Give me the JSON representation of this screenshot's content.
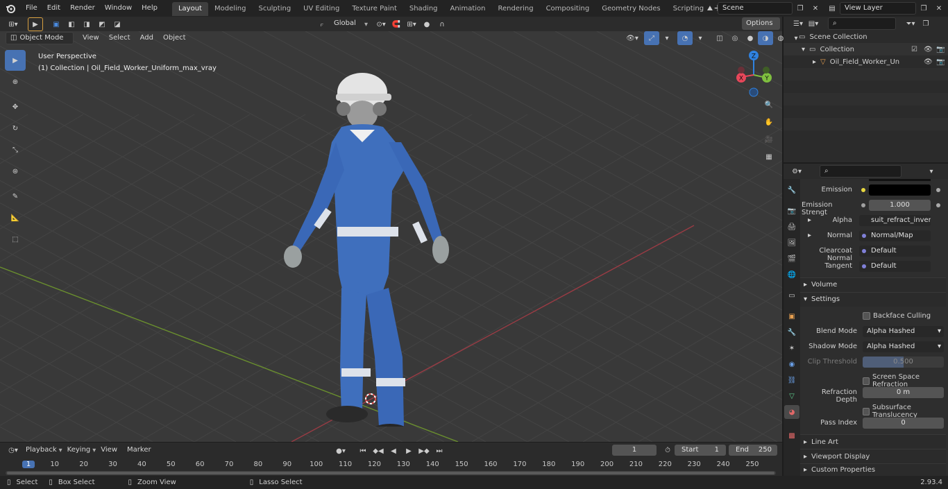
{
  "topbar": {
    "menus": [
      "File",
      "Edit",
      "Render",
      "Window",
      "Help"
    ],
    "workspaces": [
      "Layout",
      "Modeling",
      "Sculpting",
      "UV Editing",
      "Texture Paint",
      "Shading",
      "Animation",
      "Rendering",
      "Compositing",
      "Geometry Nodes",
      "Scripting"
    ],
    "active_workspace": "Layout",
    "scene": "Scene",
    "view_layer": "View Layer"
  },
  "viewport": {
    "mode": "Object Mode",
    "menus": [
      "View",
      "Select",
      "Add",
      "Object"
    ],
    "transform": "Global",
    "options": "Options",
    "perspective": "User Perspective",
    "collection_info": "(1) Collection | Oil_Field_Worker_Uniform_max_vray",
    "gizmo": {
      "z": "Z",
      "y": "Y",
      "x": "X"
    }
  },
  "outliner": {
    "scene_collection": "Scene Collection",
    "collection": "Collection",
    "object": "Oil_Field_Worker_Uniform"
  },
  "properties": {
    "emission_label": "Emission",
    "emission_strength_label": "Emission Strengt",
    "emission_strength": "1.000",
    "alpha_label": "Alpha",
    "alpha_value": "suit_refract_invert.pn",
    "normal_label": "Normal",
    "normal_value": "Normal/Map",
    "clearcoat_label": "Clearcoat Normal",
    "clearcoat_value": "Default",
    "tangent_label": "Tangent",
    "tangent_value": "Default",
    "volume": "Volume",
    "settings": "Settings",
    "backface": "Backface Culling",
    "blend_label": "Blend Mode",
    "blend_value": "Alpha Hashed",
    "shadow_label": "Shadow Mode",
    "shadow_value": "Alpha Hashed",
    "clip_label": "Clip Threshold",
    "clip_value": "0.500",
    "ssr": "Screen Space Refraction",
    "refr_label": "Refraction Depth",
    "refr_value": "0 m",
    "sst": "Subsurface Translucency",
    "pass_label": "Pass Index",
    "pass_value": "0",
    "line_art": "Line Art",
    "viewport_display": "Viewport Display",
    "custom_props": "Custom Properties"
  },
  "timeline": {
    "menus": [
      "Playback",
      "Keying",
      "View",
      "Marker"
    ],
    "current_frame": "1",
    "start_label": "Start",
    "start": "1",
    "end_label": "End",
    "end": "250",
    "ruler": [
      "1",
      "10",
      "20",
      "30",
      "40",
      "50",
      "60",
      "70",
      "80",
      "90",
      "100",
      "110",
      "120",
      "130",
      "140",
      "150",
      "160",
      "170",
      "180",
      "190",
      "200",
      "210",
      "220",
      "230",
      "240",
      "250"
    ]
  },
  "statusbar": {
    "select": "Select",
    "box_select": "Box Select",
    "zoom_view": "Zoom View",
    "lasso_select": "Lasso Select",
    "version": "2.93.4"
  },
  "colors": {
    "accent": "#4772b3",
    "x_axis": "#e8475a",
    "y_axis": "#7fbf3f",
    "z_axis": "#2f82e0"
  }
}
